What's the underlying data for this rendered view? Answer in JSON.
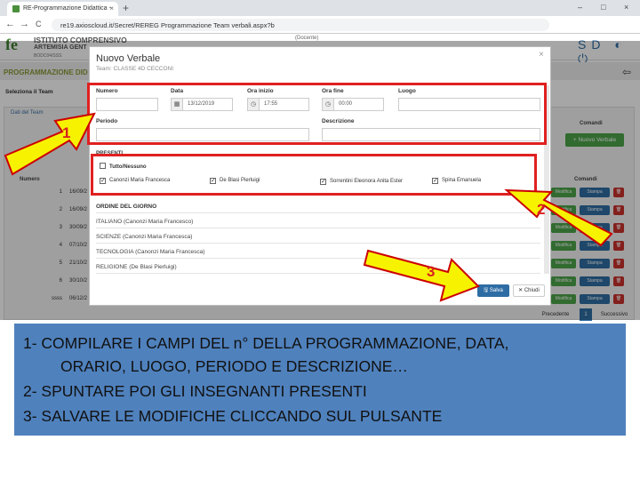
{
  "browser": {
    "tab_title": "RE-Programmazione Didattica -",
    "tab_close": "×",
    "new_tab": "+",
    "url": "re19.axioscloud.it/Secret/REREG Programmazione Team verbali.aspx?b",
    "nav_back": "←",
    "nav_forward": "→",
    "nav_reload": "C",
    "window_controls": [
      "–",
      "□",
      "×"
    ]
  },
  "app": {
    "logo": "fe",
    "school_line1": "ISTITUTO COMPRENSIVO",
    "school_line2": "ARTEMISIA GENT",
    "school_line3": "BODC04/SSS",
    "docente_label": "(Docente)",
    "header_icons": "SD ◐ ⏻",
    "page_title": "PROGRAMMAZIONE DID",
    "back_icon": "⇦"
  },
  "background": {
    "select_team_label": "Seleziona il Team",
    "dati_team": "Dati del Team",
    "comandi_top": "Comandi",
    "nuovo_verbale": "+ Nuovo Verbale",
    "comandi": "Comandi",
    "numero": "Numero",
    "rows": [
      {
        "n": "1",
        "d": "16/09/2"
      },
      {
        "n": "2",
        "d": "16/09/2"
      },
      {
        "n": "3",
        "d": "30/09/2"
      },
      {
        "n": "4",
        "d": "07/10/2"
      },
      {
        "n": "5",
        "d": "21/10/2"
      },
      {
        "n": "6",
        "d": "30/10/2"
      },
      {
        "n": "ssss",
        "d": "06/12/2"
      }
    ],
    "btn_modifica": "Modifica",
    "btn_stampa": "Stampa",
    "btn_del": "🗑",
    "prev": "Precedente",
    "page": "1",
    "next": "Successivo"
  },
  "modal": {
    "title": "Nuovo Verbale",
    "subtitle": "Team: CLASSE 4D CECCONI",
    "close": "×",
    "labels": {
      "numero": "Numero",
      "data": "Data",
      "ora_inizio": "Ora inizio",
      "ora_fine": "Ora fine",
      "luogo": "Luogo",
      "periodo": "Periodo",
      "descrizione": "Descrizione"
    },
    "values": {
      "data": "13/12/2019",
      "ora_inizio": "17:55",
      "ora_fine": "00:00"
    },
    "presenti_label": "PRESENTI",
    "tutto_nessuno": "Tutto/Nessuno",
    "teachers": [
      "Canonzi Maria Francesca",
      "De Blasi Pierluigi",
      "Sorrentini Eleonora Anita Ester",
      "Spina Emanuela"
    ],
    "ordine_label": "ORDINE DEL GIORNO",
    "subjects": [
      "ITALIANO (Canonzi Maria Francesco)",
      "SCIENZE (Canonzi Maria Francesca)",
      "TECNOLOGIA (Canonzi Maria Francesca)",
      "RELIGIONE (De Blasi Pierluigi)"
    ],
    "save": "Salva",
    "close_btn": "Chiudi"
  },
  "annotations": {
    "n1": "1",
    "n2": "2",
    "n3": "3",
    "color": "#e02020",
    "arrow_color": "#f7f300"
  },
  "caption": {
    "line1": "1- COMPILARE I CAMPI DEL n° DELLA PROGRAMMAZIONE, DATA,",
    "line2": "ORARIO, LUOGO, PERIODO E DESCRIZIONE…",
    "line3": "2- SPUNTARE POI GLI INSEGNANTI PRESENTI",
    "line4": "3- SALVARE LE MODIFICHE CLICCANDO SUL PULSANTE",
    "bg_color": "#4f81bd"
  }
}
